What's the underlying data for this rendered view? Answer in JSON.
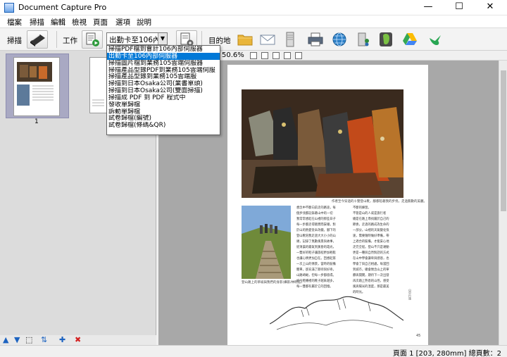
{
  "window": {
    "title": "Document Capture Pro",
    "min": "—",
    "max": "☐",
    "close": "✕"
  },
  "menu": [
    "檔案",
    "掃描",
    "編輯",
    "檢視",
    "頁面",
    "選項",
    "說明"
  ],
  "toolbar": {
    "scan_label": "掃描",
    "job_label": "工作",
    "job_value": "出勤卡至106內部伺服器",
    "dest_label": "目的地",
    "dest_icons": [
      "folder-icon",
      "mail-icon",
      "server-icon",
      "printer-icon",
      "globe-icon",
      "sharepoint-icon",
      "evernote-icon",
      "google-drive-icon",
      "bird-icon"
    ]
  },
  "job_options": [
    "掃描PDF檔到會計106內部伺服器",
    "出勤卡至106內部伺服器",
    "掃描圖片檔到業務105雲端伺服器",
    "掃描產品型錄PDF到業務105雲端伺服",
    "掃描產品型錄到業務105雲端服",
    "掃描到日本Osaka公司(業書單頭)",
    "掃描到日本Osaka公司(雙面掃描)",
    "掃描成 PDF 到 PDF 程式中",
    "發收單歸檔",
    "訴動單歸檔",
    "試卷歸檔(編號)",
    "試卷歸檔(條碼&QR)"
  ],
  "selected_job_index": 1,
  "thumbnails": {
    "page_number": "1"
  },
  "viewer": {
    "zoom": "50.6%",
    "caption_main": "作者至今穿過的十雙登山靴，腳都陪著我的步伐，走過無數的美麗。",
    "caption_small": "登山路上的草坡與我們的身影(攝影/林明志)",
    "page_no": "45",
    "side_text": "山中行旅"
  },
  "article": {
    "col1": [
      "想念中不斷向前走的路途，每",
      "個步伐都記錄著山中的一切",
      "我常常想起在山裡的那些日子",
      "每一步都走得踏實而安穩，對",
      "於山的熱愛從未改變。腳下的",
      "登山靴陪我走過大大小小的山",
      "頭，記錄了無數風景與故事，",
      "從清晨的霧氣到黃昏的霞光，",
      "一雙好的鞋子讓旅程更加輕鬆",
      "也讓心情更加自在。回想起第",
      "一次上山的情景，當時的裝備",
      "簡單，卻充滿了期待與好奇，",
      "山路崎嶇，但每一步都值得。",
      "如今鞋櫃裡的靴子越來越多，",
      "每一雙都有屬於它的回憶。"
    ],
    "col2": [
      "不斷的練習。",
      "不管是山的人或是旅行者",
      "總是在路上尋找屬於自己的",
      "節奏，走過的路成為生命的",
      "一部分。山裡的天氣變化快",
      "速，需要隨時做好準備，帶",
      "上適合的裝備，才能安心地",
      "走完全程。登山不只是運動",
      "更是一種與自然對話的方式",
      "在山中學會謙卑與感恩，也",
      "學會了與自己相處。每當回",
      "到城市，總會懷念山上的寧",
      "靜與開闊，期待下一次出發",
      "再次踏上熟悉的山徑，感受",
      "風與陽光的溫度，那是最美",
      "的時光。"
    ]
  },
  "left_footer_icons": [
    "arrow-up-icon",
    "arrow-down-icon",
    "select-icon",
    "sort-icon",
    "add-icon",
    "delete-icon"
  ],
  "status": {
    "text": "頁面 1 [203, 280mm]  總頁數：2"
  }
}
